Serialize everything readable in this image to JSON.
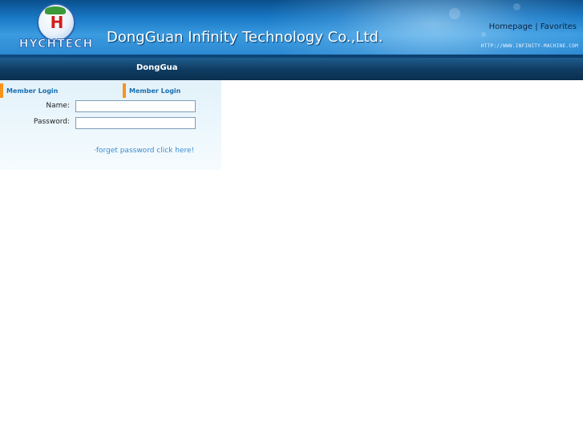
{
  "header": {
    "logo_mark": "H",
    "logo_wordmark": "HYCHTECH",
    "company_name": "DongGuan Infinity Technology Co.,Ltd.",
    "links": {
      "homepage": "Homepage",
      "separator": "|",
      "favorites": "Favorites"
    },
    "site_url": "HTTP://WWW.INFINITY-MACHINE.COM"
  },
  "navbar": {
    "marquee_text": "DongGuan"
  },
  "login": {
    "tabs": [
      "Member Login",
      "Member Login"
    ],
    "name_label": "Name:",
    "name_value": "",
    "password_label": "Password:",
    "password_value": "",
    "forgot_link": "·forget password click here!"
  },
  "colors": {
    "header_blue": "#1877c4",
    "nav_dark": "#103d63",
    "tab_accent": "#f7941d",
    "link_blue": "#3a8ccf",
    "logo_red": "#d11d1d"
  }
}
